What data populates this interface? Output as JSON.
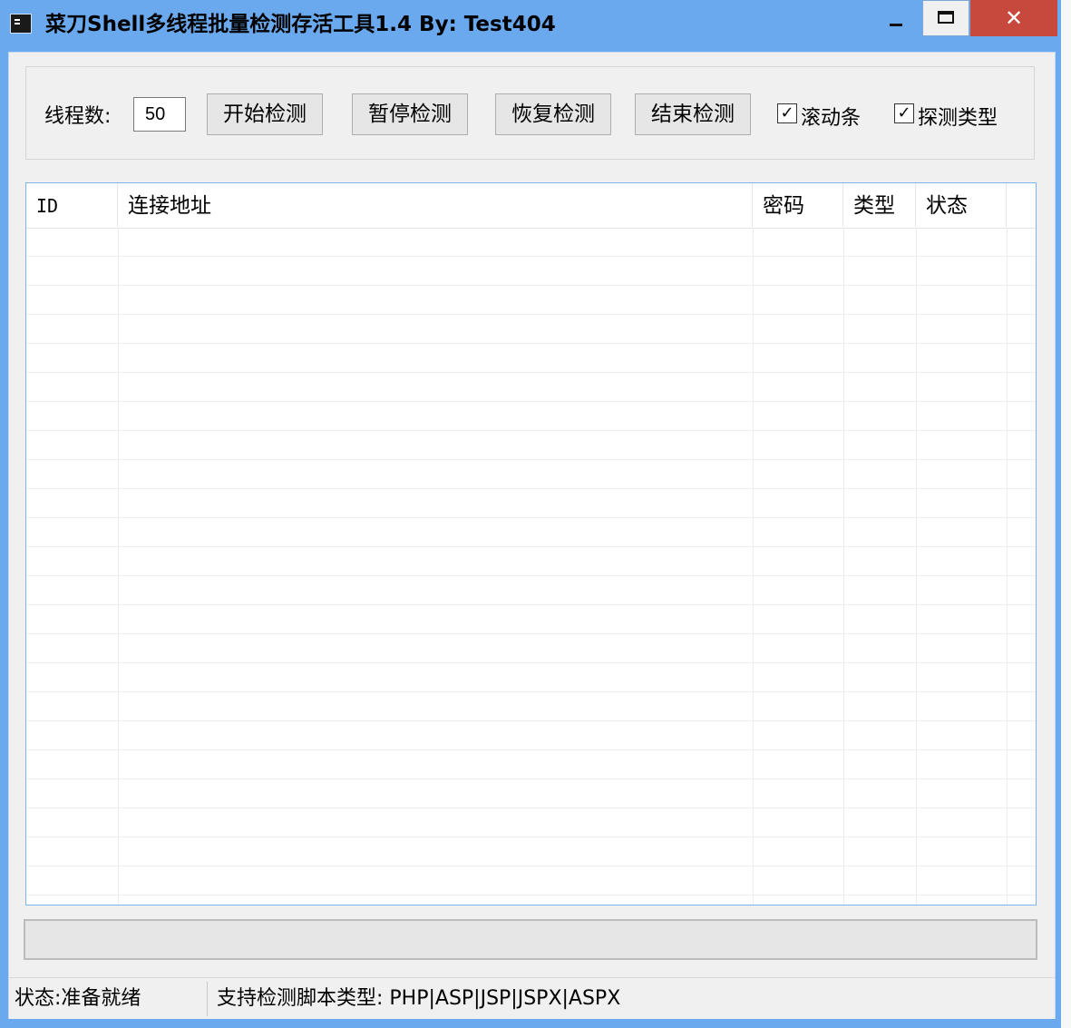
{
  "window": {
    "title": "菜刀Shell多线程批量检测存活工具1.4   By: Test404",
    "close_glyph": "✕"
  },
  "toolbar": {
    "threads_label": "线程数:",
    "threads_value": "50",
    "start_label": "开始检测",
    "pause_label": "暂停检测",
    "resume_label": "恢复检测",
    "stop_label": "结束检测",
    "scrollbar_label": "滚动条",
    "scrollbar_checked": true,
    "detect_type_label": "探测类型",
    "detect_type_checked": true,
    "check_glyph": "✓"
  },
  "table": {
    "columns": [
      "ID",
      "连接地址",
      "密码",
      "类型",
      "状态"
    ],
    "rows": []
  },
  "progress": {
    "value": 0
  },
  "statusbar": {
    "status": "状态:准备就绪",
    "supported": "支持检测脚本类型: PHP|ASP|JSP|JSPX|ASPX"
  }
}
